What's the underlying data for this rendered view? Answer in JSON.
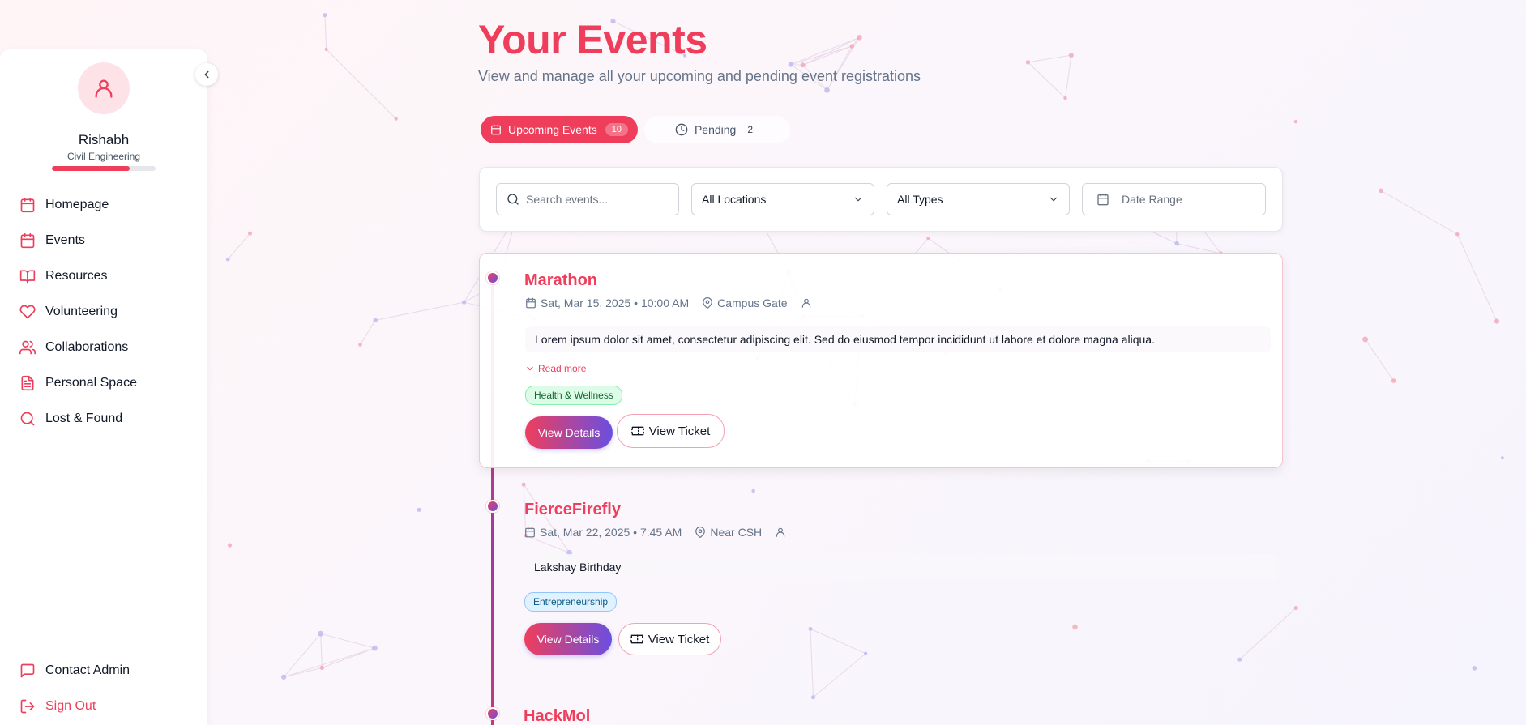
{
  "colors": {
    "accent": "#ef3e5c",
    "gradient_end": "#6a4fe0",
    "muted": "#64748b"
  },
  "sidebar": {
    "user": {
      "name": "Rishabh",
      "department": "Civil Engineering",
      "profile_progress": 0.75
    },
    "items": [
      {
        "label": "Homepage",
        "icon": "calendar-icon"
      },
      {
        "label": "Events",
        "icon": "calendar-icon"
      },
      {
        "label": "Resources",
        "icon": "book-icon"
      },
      {
        "label": "Volunteering",
        "icon": "heart-icon"
      },
      {
        "label": "Collaborations",
        "icon": "users-icon"
      },
      {
        "label": "Personal Space",
        "icon": "document-icon"
      },
      {
        "label": "Lost & Found",
        "icon": "search-icon"
      }
    ],
    "bottom": [
      {
        "label": "Contact Admin",
        "icon": "message-icon"
      },
      {
        "label": "Sign Out",
        "icon": "logout-icon"
      }
    ]
  },
  "header": {
    "title": "Your Events",
    "subtitle": "View and manage all your upcoming and pending event registrations"
  },
  "tabs": [
    {
      "label": "Upcoming Events",
      "count": "10",
      "icon": "calendar-icon",
      "active": true
    },
    {
      "label": "Pending",
      "count": "2",
      "icon": "clock-icon",
      "active": false
    }
  ],
  "filters": {
    "search_placeholder": "Search events...",
    "location": "All Locations",
    "type": "All Types",
    "date_placeholder": "Date Range"
  },
  "events": [
    {
      "title": "Marathon",
      "date": "Sat, Mar 15, 2025 • 10:00 AM",
      "location": "Campus Gate",
      "description": "Lorem ipsum dolor sit amet, consectetur adipiscing elit. Sed do eiusmod tempor incididunt ut labore et dolore magna aliqua.",
      "read_more": "Read more",
      "tag": "Health & Wellness",
      "details_label": "View Details",
      "ticket_label": "View Ticket"
    },
    {
      "title": "FierceFirefly",
      "date": "Sat, Mar 22, 2025 • 7:45 AM",
      "location": "Near CSH",
      "description": "Lakshay Birthday",
      "tag": "Entrepreneurship",
      "details_label": "View Details",
      "ticket_label": "View Ticket"
    },
    {
      "title": "HackMol"
    }
  ]
}
